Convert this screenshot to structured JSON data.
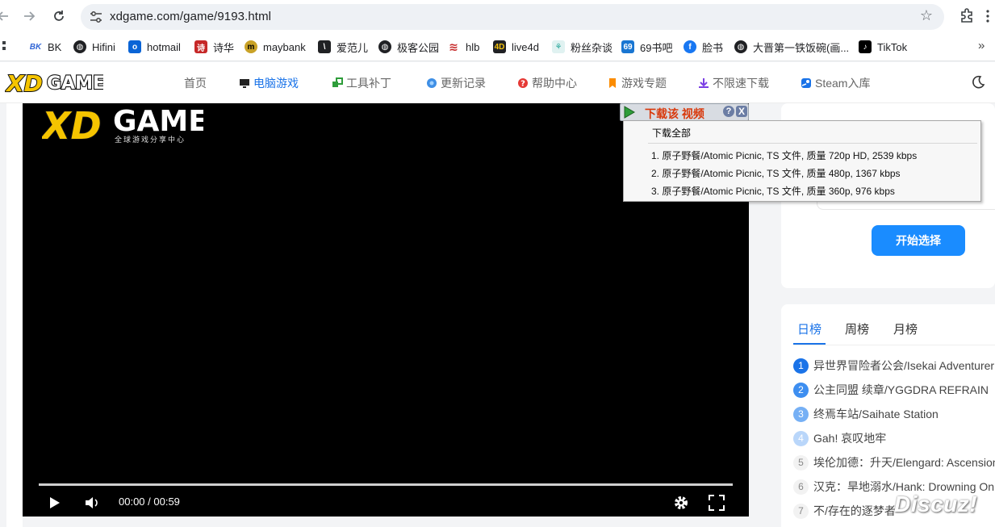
{
  "browser": {
    "url": "xdgame.com/game/9193.html"
  },
  "bookmarks": [
    {
      "label": "BK",
      "icon": "bk-icon",
      "color": "#3367d6"
    },
    {
      "label": "Hifini",
      "icon": "globe-icon",
      "color": "#202124"
    },
    {
      "label": "hotmail",
      "icon": "outlook-icon",
      "color": "#0a64d6"
    },
    {
      "label": "诗华",
      "icon": "shihua-icon",
      "color": "#c62828"
    },
    {
      "label": "maybank",
      "icon": "maybank-icon",
      "color": "#c9a227"
    },
    {
      "label": "爱范儿",
      "icon": "ifanr-icon",
      "color": "#202124"
    },
    {
      "label": "极客公园",
      "icon": "globe-icon",
      "color": "#202124"
    },
    {
      "label": "hlb",
      "icon": "hlb-icon",
      "color": "#c62828"
    },
    {
      "label": "live4d",
      "icon": "live4d-icon",
      "color": "#202124"
    },
    {
      "label": "粉丝杂谈",
      "icon": "fans-icon",
      "color": "#26a69a"
    },
    {
      "label": "69书吧",
      "icon": "69-icon",
      "color": "#1976d2"
    },
    {
      "label": "脸书",
      "icon": "facebook-icon",
      "color": "#1877f2"
    },
    {
      "label": "大晋第一铁饭碗(画...",
      "icon": "globe-icon",
      "color": "#202124"
    },
    {
      "label": "TikTok",
      "icon": "tiktok-icon",
      "color": "#000000"
    }
  ],
  "site": {
    "logo_text": "XD GAME",
    "logo_sub": "全球游戏分享中心",
    "menu": [
      {
        "label": "首页",
        "icon": ""
      },
      {
        "label": "电脑游戏",
        "icon": "monitor-icon",
        "active": true
      },
      {
        "label": "工具补丁",
        "icon": "tools-icon"
      },
      {
        "label": "更新记录",
        "icon": "update-icon"
      },
      {
        "label": "帮助中心",
        "icon": "help-icon"
      },
      {
        "label": "游戏专题",
        "icon": "bookmark-icon"
      },
      {
        "label": "不限速下载",
        "icon": "download-icon"
      },
      {
        "label": "Steam入库",
        "icon": "steam-icon"
      }
    ]
  },
  "player": {
    "time": "00:00 / 00:59",
    "progress": 0
  },
  "download_popup": {
    "bar_label": "下载该 视频",
    "help": "?",
    "close": "X",
    "download_all": "下载全部",
    "items": [
      "1.  原子野餐/Atomic Picnic,  TS 文件, 质量 720p HD, 2539 kbps",
      "2.  原子野餐/Atomic Picnic,  TS 文件, 质量 480p, 1367 kbps",
      "3.  原子野餐/Atomic Picnic,  TS 文件, 质量 360p, 976 kbps"
    ]
  },
  "sidebar": {
    "start_button": "开始选择",
    "tabs": [
      "日榜",
      "周榜",
      "月榜"
    ],
    "ranking": [
      {
        "rank": "1",
        "title": "异世界冒险者公会/Isekai Adventurer"
      },
      {
        "rank": "2",
        "title": "公主同盟 续章/YGGDRA REFRAIN"
      },
      {
        "rank": "3",
        "title": "终焉车站/Saihate Station"
      },
      {
        "rank": "4",
        "title": "Gah! 哀叹地牢"
      },
      {
        "rank": "5",
        "title": "埃伦加德：升天/Elengard: Ascension"
      },
      {
        "rank": "6",
        "title": "汉克：旱地溺水/Hank: Drowning On"
      },
      {
        "rank": "7",
        "title": "不/存在的逐梦者"
      }
    ]
  },
  "watermark": "Discuz!",
  "colors": {
    "accent": "#1a73e8",
    "button": "#1a8cff",
    "popup_text": "#d9380b"
  }
}
